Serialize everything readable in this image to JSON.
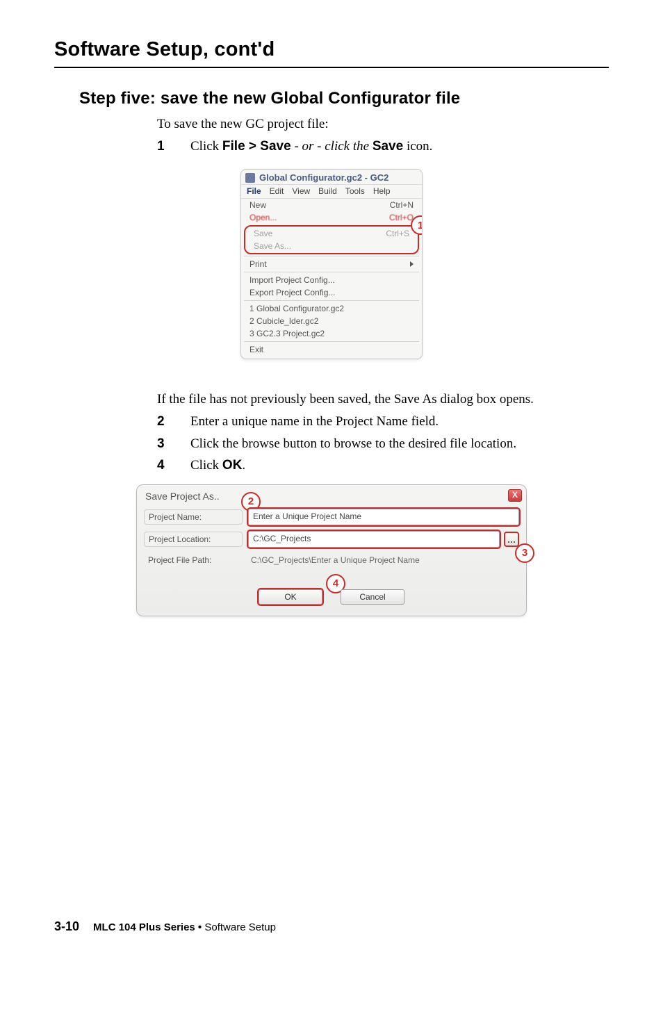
{
  "headings": {
    "section_title": "Software Setup, cont'd",
    "step_title": "Step five: save the new Global Configurator file"
  },
  "paragraphs": {
    "intro": "To save the new GC project file:",
    "after_menu": "If the file has not previously been saved, the Save As dialog box opens."
  },
  "steps": {
    "s1": {
      "num": "1",
      "prefix": "Click ",
      "bold1": "File > Save",
      "mid": " - or - click the ",
      "bold2": "Save",
      "suffix": " icon."
    },
    "s2": {
      "num": "2",
      "text": "Enter a unique name in the Project Name field."
    },
    "s3": {
      "num": "3",
      "text": "Click the browse button to browse to the desired file location."
    },
    "s4": {
      "num": "4",
      "prefix": "Click ",
      "bold": "OK",
      "suffix": "."
    }
  },
  "menu": {
    "title": "Global Configurator.gc2 - GC2",
    "bar": [
      "File",
      "Edit",
      "View",
      "Build",
      "Tools",
      "Help"
    ],
    "items": {
      "new": "New",
      "new_sc": "Ctrl+N",
      "open": "Open...",
      "open_sc": "Ctrl+O",
      "save": "Save",
      "save_sc": "Ctrl+S",
      "saveas": "Save As...",
      "print": "Print",
      "import": "Import Project Config...",
      "export": "Export Project Config...",
      "r1": "1 Global Configurator.gc2",
      "r2": "2 Cubicle_Ider.gc2",
      "r3": "3 GC2.3 Project.gc2",
      "exit": "Exit"
    },
    "badge": "1"
  },
  "dialog": {
    "title": "Save Project As..",
    "labels": {
      "name": "Project Name:",
      "loc": "Project Location:",
      "path": "Project File Path:"
    },
    "values": {
      "name": "Enter a Unique Project Name",
      "loc": "C:\\GC_Projects",
      "path": "C:\\GC_Projects\\Enter a Unique Project Name"
    },
    "buttons": {
      "ok": "OK",
      "cancel": "Cancel"
    },
    "badges": {
      "b2": "2",
      "b3": "3",
      "b4": "4"
    },
    "close": "X"
  },
  "footer": {
    "page": "3-10",
    "bold": "MLC 104 Plus Series • ",
    "light": "Software Setup"
  }
}
